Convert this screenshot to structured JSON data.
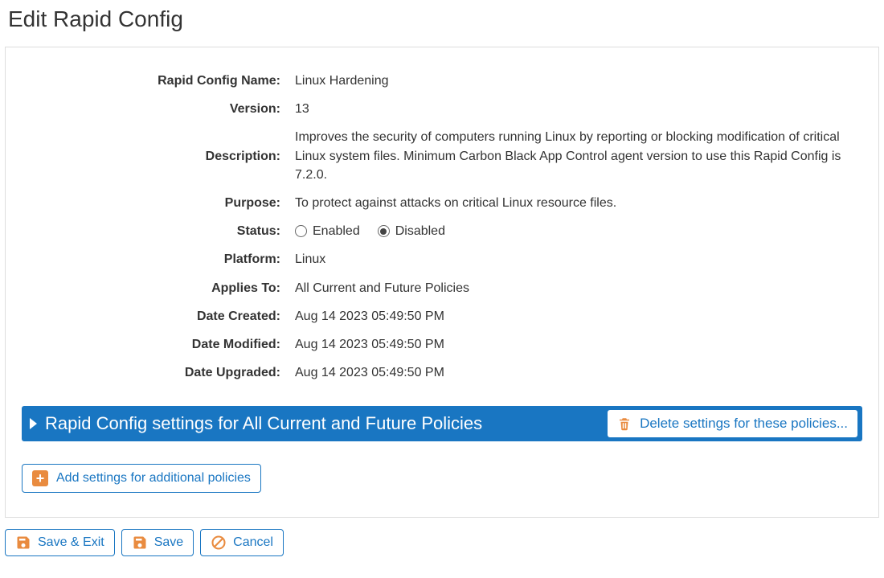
{
  "page": {
    "title": "Edit Rapid Config"
  },
  "form": {
    "labels": {
      "name": "Rapid Config Name:",
      "version": "Version:",
      "description": "Description:",
      "purpose": "Purpose:",
      "status": "Status:",
      "platform": "Platform:",
      "appliesTo": "Applies To:",
      "dateCreated": "Date Created:",
      "dateModified": "Date Modified:",
      "dateUpgraded": "Date Upgraded:"
    },
    "values": {
      "name": "Linux Hardening",
      "version": "13",
      "description": "Improves the security of computers running Linux by reporting or blocking modification of critical Linux system files. Minimum Carbon Black App Control agent version to use this Rapid Config is 7.2.0.",
      "purpose": "To protect against attacks on critical Linux resource files.",
      "platform": "Linux",
      "appliesTo": "All Current and Future Policies",
      "dateCreated": "Aug 14 2023 05:49:50 PM",
      "dateModified": "Aug 14 2023 05:49:50 PM",
      "dateUpgraded": "Aug 14 2023 05:49:50 PM"
    },
    "status": {
      "enabledLabel": "Enabled",
      "disabledLabel": "Disabled",
      "selected": "disabled"
    }
  },
  "settingsBar": {
    "title": "Rapid Config settings for All Current and Future Policies",
    "deleteLabel": "Delete settings for these policies..."
  },
  "addSettings": {
    "label": "Add settings for additional policies"
  },
  "actions": {
    "saveExit": "Save & Exit",
    "save": "Save",
    "cancel": "Cancel"
  },
  "colors": {
    "primary": "#1976c2",
    "accent": "#e98b3f"
  }
}
